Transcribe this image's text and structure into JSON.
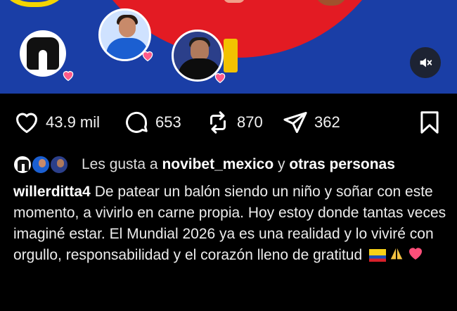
{
  "media": {
    "colors": {
      "blue": "#1a3ea6",
      "red": "#e31b23",
      "yellow": "#f4d400"
    },
    "mute_icon": "speaker-muted-icon"
  },
  "actions": {
    "likes": "43.9 mil",
    "comments": "653",
    "reposts": "870",
    "shares": "362",
    "icons": [
      "heart-icon",
      "comment-icon",
      "repost-icon",
      "send-icon",
      "bookmark-icon"
    ]
  },
  "liked_by": {
    "prefix": "Les gusta a",
    "user": "novibet_mexico",
    "connector": "y",
    "others": "otras personas"
  },
  "caption": {
    "username": "willerditta4",
    "text": "De patear un balón siendo un niño y soñar con este momento, a vivirlo en carne propia. Hoy estoy donde tantas veces imaginé estar. El Mundial 2026 ya es una realidad y lo viviré con orgullo, responsabilidad y el corazón lleno de gratitud",
    "emojis": [
      "flag-colombia-icon",
      "praying-hands-icon",
      "heart-icon"
    ]
  }
}
